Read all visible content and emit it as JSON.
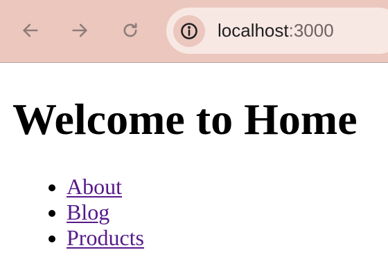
{
  "browser": {
    "url_host": "localhost",
    "url_port": ":3000",
    "icons": {
      "back": "arrow-left-icon",
      "forward": "arrow-right-icon",
      "reload": "reload-icon",
      "site_info": "info-icon"
    },
    "colors": {
      "toolbar": "#ebc7be",
      "omnibox": "#f8e8e4",
      "icon": "#8d7c79"
    }
  },
  "page": {
    "title": "Welcome to Home",
    "links": [
      {
        "label": "About"
      },
      {
        "label": "Blog"
      },
      {
        "label": "Products"
      }
    ],
    "colors": {
      "visited_link": "#551a8b",
      "text": "#000000"
    }
  }
}
